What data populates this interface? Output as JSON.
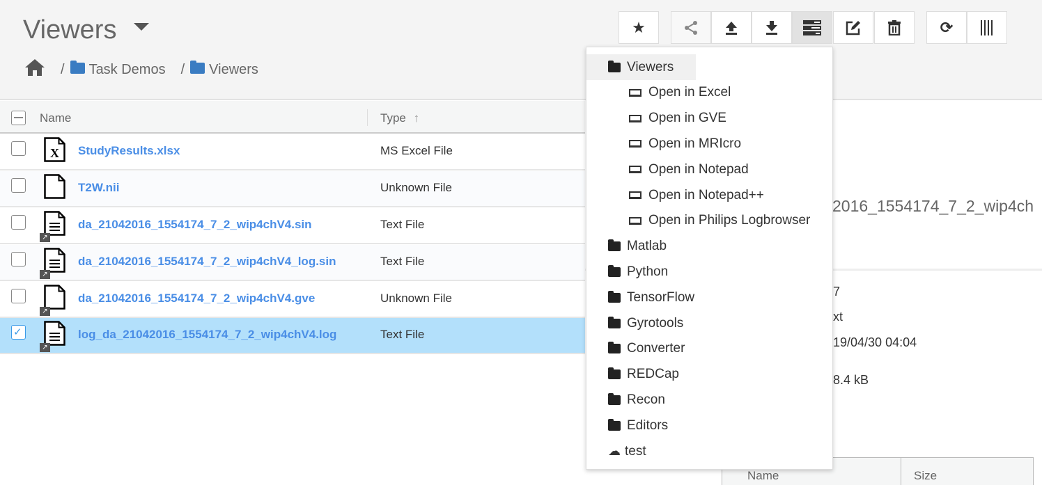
{
  "header": {
    "title": "Viewers",
    "breadcrumb": [
      "Task Demos",
      "Viewers"
    ]
  },
  "toolbar": [
    "star-icon",
    "share-icon",
    "upload-icon",
    "download-icon",
    "viewers-menu-icon",
    "edit-icon",
    "trash-icon",
    "refresh-icon",
    "barcode-icon"
  ],
  "table": {
    "columns": [
      "Name",
      "Type"
    ],
    "rows": [
      {
        "name": "StudyResults.xlsx",
        "type": "MS Excel File",
        "icon": "excel",
        "link": false,
        "checked": false
      },
      {
        "name": "T2W.nii",
        "type": "Unknown File",
        "icon": "blank",
        "link": false,
        "checked": false
      },
      {
        "name": "da_21042016_1554174_7_2_wip4chV4.sin",
        "type": "Text File",
        "icon": "text",
        "link": true,
        "checked": false
      },
      {
        "name": "da_21042016_1554174_7_2_wip4chV4_log.sin",
        "type": "Text File",
        "icon": "text",
        "link": true,
        "checked": false
      },
      {
        "name": "da_21042016_1554174_7_2_wip4chV4.gve",
        "type": "Unknown File",
        "icon": "blank",
        "link": true,
        "checked": false
      },
      {
        "name": "log_da_21042016_1554174_7_2_wip4chV4.log",
        "type": "Text File",
        "icon": "text",
        "link": true,
        "checked": true
      }
    ]
  },
  "details": {
    "title_partial": "2016_1554174_7_2_wip4ch",
    "v1": "7",
    "v2": "xt",
    "date": "19/04/30 04:04",
    "size": "8.4 kB",
    "sub_columns": [
      "Name",
      "Size"
    ]
  },
  "menu": {
    "items": [
      {
        "label": "Viewers",
        "kind": "folder",
        "level": 0
      },
      {
        "label": "Open in Excel",
        "kind": "app",
        "level": 1
      },
      {
        "label": "Open in GVE",
        "kind": "app",
        "level": 1
      },
      {
        "label": "Open in MRIcro",
        "kind": "app",
        "level": 1
      },
      {
        "label": "Open in Notepad",
        "kind": "app",
        "level": 1
      },
      {
        "label": "Open in Notepad++",
        "kind": "app",
        "level": 1
      },
      {
        "label": "Open in Philips Logbrowser",
        "kind": "app",
        "level": 1
      },
      {
        "label": "Matlab",
        "kind": "folder",
        "level": 0
      },
      {
        "label": "Python",
        "kind": "folder",
        "level": 0
      },
      {
        "label": "TensorFlow",
        "kind": "folder",
        "level": 0
      },
      {
        "label": "Gyrotools",
        "kind": "folder",
        "level": 0
      },
      {
        "label": "Converter",
        "kind": "folder",
        "level": 0
      },
      {
        "label": "REDCap",
        "kind": "folder",
        "level": 0
      },
      {
        "label": "Recon",
        "kind": "folder",
        "level": 0
      },
      {
        "label": "Editors",
        "kind": "folder",
        "level": 0
      },
      {
        "label": "test",
        "kind": "cloud",
        "level": 0
      }
    ]
  }
}
